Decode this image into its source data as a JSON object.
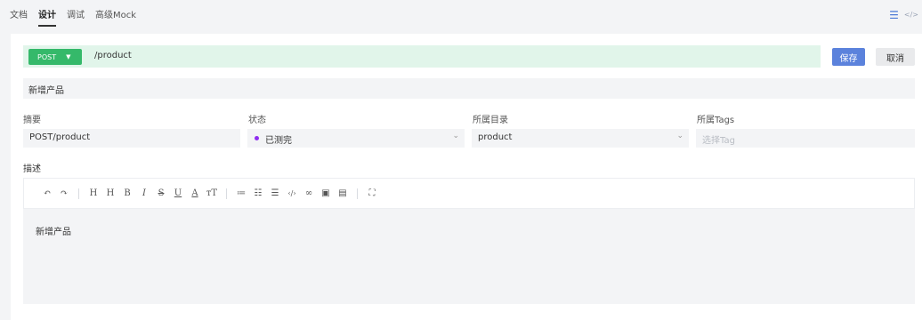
{
  "tabs": [
    {
      "label": "文档",
      "active": false
    },
    {
      "label": "设计",
      "active": true
    },
    {
      "label": "调试",
      "active": false
    },
    {
      "label": "高级Mock",
      "active": false
    }
  ],
  "top_actions": {
    "list_icon": "☰",
    "code_icon": "</>"
  },
  "request": {
    "method": "POST",
    "path": "/product"
  },
  "buttons": {
    "save": "保存",
    "cancel": "取消"
  },
  "title_value": "新增产品",
  "fields": {
    "summary": {
      "label": "摘要",
      "value": "POST/product"
    },
    "status": {
      "label": "状态",
      "value": "已测完",
      "dot_color": "#8f2ef0"
    },
    "directory": {
      "label": "所属目录",
      "value": "product"
    },
    "tags": {
      "label": "所属Tags",
      "placeholder": "选择Tag"
    }
  },
  "description": {
    "label": "描述",
    "content": "新增产品"
  },
  "toolbar_icons": [
    "undo-icon",
    "redo-icon",
    "heading-icon",
    "heading-size-icon",
    "bold-icon",
    "italic-icon",
    "strikethrough-icon",
    "underline-icon",
    "font-color-icon",
    "font-size-icon",
    "bullet-list-icon",
    "ordered-list-icon",
    "task-list-icon",
    "code-icon",
    "link-icon",
    "image-icon",
    "table-icon",
    "fullscreen-icon"
  ],
  "colors": {
    "accent": "#5b82dc",
    "method_bg": "#35b96a",
    "urlbar_bg": "#e1f5ea"
  }
}
